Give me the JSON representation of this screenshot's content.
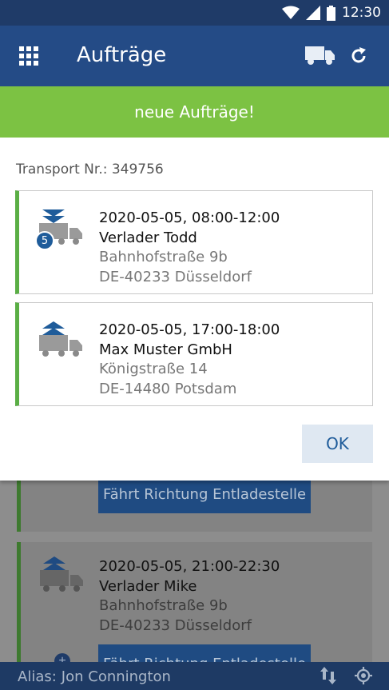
{
  "status_bar": {
    "time": "12:30",
    "icons": [
      "wifi-icon",
      "signal-icon",
      "battery-icon"
    ]
  },
  "app_bar": {
    "title": "Aufträge",
    "icons": [
      "grid-menu-icon",
      "truck-icon",
      "refresh-icon"
    ]
  },
  "banner": {
    "text": "neue Aufträge!"
  },
  "dialog": {
    "transport_label": "Transport Nr.: 349756",
    "stops": [
      {
        "type": "unload",
        "badge": "5",
        "time": "2020-05-05, 08:00-12:00",
        "name": "Verlader Todd",
        "street": "Bahnhofstraße 9b",
        "city": "DE-40233 Düsseldorf"
      },
      {
        "type": "load",
        "badge": "",
        "time": "2020-05-05, 17:00-18:00",
        "name": "Max Muster GmbH",
        "street": "Königstraße 14",
        "city": "DE-14480 Potsdam"
      }
    ],
    "ok_label": "OK"
  },
  "background": {
    "button_label_1": "Fährt Richtung Entladestelle",
    "stop": {
      "time": "2020-05-05, 21:00-22:30",
      "name": "Verlader Mike",
      "street": "Bahnhofstraße 9b",
      "city": "DE-40233 Düsseldorf"
    },
    "button_label_2": "Fährt Richtung Entladestelle"
  },
  "footer": {
    "alias_label": "Alias:",
    "alias_name": "Jon Connington",
    "icons": [
      "sort-icon",
      "location-icon"
    ]
  },
  "colors": {
    "header": "#244b86",
    "status_bar": "#1f3b68",
    "banner": "#7cc243",
    "accent_green": "#5aae45",
    "button_blue": "#1f5c9a"
  }
}
